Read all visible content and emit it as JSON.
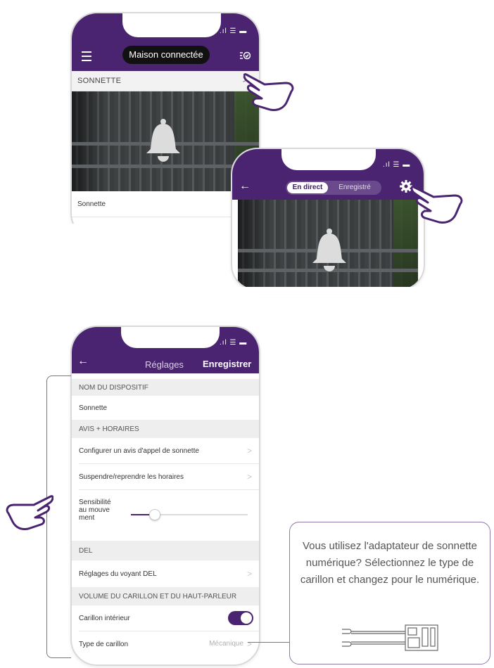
{
  "colors": {
    "brand": "#4a2470",
    "toggle_on": "#4a2470",
    "callout_border": "#8e79a8"
  },
  "screen1": {
    "title": "Maison connectée",
    "menu_icon": "menu-icon",
    "edit_icon": "edit-list-icon",
    "section_label": "SONNETTE",
    "camera_caption": "Sonnette"
  },
  "screen2": {
    "tab_live": "En direct",
    "tab_recorded": "Enregistré",
    "back_icon": "back-arrow-icon",
    "settings_icon": "gear-icon"
  },
  "screen3": {
    "title": "Réglages",
    "save_label": "Enregistrer",
    "device_name_header": "NOM DU DISPOSITIF",
    "device_name_value": "Sonnette",
    "alerts_header": "AVIS + HORAIRES",
    "configure_alert": "Configurer un avis d'appel de sonnette",
    "suspend_schedule": "Suspendre/reprendre les horaires",
    "motion_sensitivity_label": "Sensibilité au mouvement",
    "motion_sensitivity_value": 0.2,
    "led_header": "DEL",
    "led_settings": "Réglages du voyant DEL",
    "volume_header": "VOLUME DU CARILLON ET DU HAUT-PARLEUR",
    "indoor_chime_label": "Carillon intérieur",
    "indoor_chime_on": true,
    "chime_type_label": "Type de carillon",
    "chime_type_value": "Mécanique"
  },
  "callout": {
    "text": "Vous utilisez l'adaptateur de sonnette numérique? Sélectionnez le type de carillon et changez pour le numérique."
  }
}
